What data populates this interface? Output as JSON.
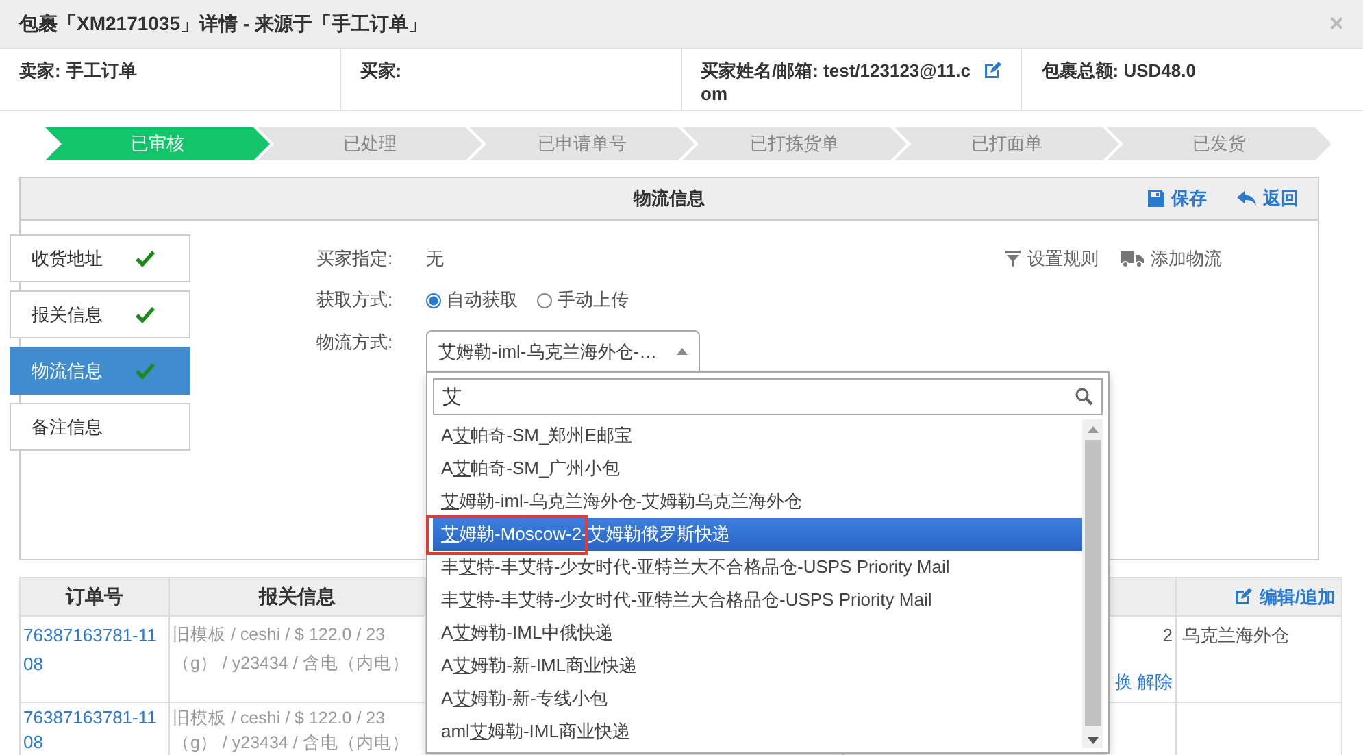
{
  "window": {
    "title_before": "包裹「",
    "title_code": "XM2171035",
    "title_after": "」详情 - 来源于「手工订单」",
    "close": "×"
  },
  "info": [
    {
      "label": "卖家:",
      "value": "手工订单",
      "editable": false
    },
    {
      "label": "买家:",
      "editable": false
    },
    {
      "label": "买家姓名/邮箱:",
      "value": "test/123123@11.com",
      "editable": true
    },
    {
      "label": "包裹总额:",
      "value": "USD48.0",
      "editable": false
    }
  ],
  "steps": [
    {
      "label": "已审核",
      "done": true
    },
    {
      "label": "已处理",
      "done": false
    },
    {
      "label": "已申请单号",
      "done": false
    },
    {
      "label": "已打拣货单",
      "done": false
    },
    {
      "label": "已打面单",
      "done": false
    },
    {
      "label": "已发货",
      "done": false
    }
  ],
  "panel": {
    "title": "物流信息",
    "actions": [
      {
        "kind": "save",
        "label": "保存"
      },
      {
        "kind": "back",
        "label": "返回"
      }
    ]
  },
  "sidebar": {
    "items": [
      {
        "label": "收货地址",
        "done": true,
        "selected": false
      },
      {
        "label": "报关信息",
        "done": true,
        "selected": false
      },
      {
        "label": "物流信息",
        "done": true,
        "selected": true
      },
      {
        "label": "备注信息",
        "done": false,
        "selected": false
      }
    ]
  },
  "form": {
    "buyer_label": "买家指定:",
    "buyer_value": "无",
    "method_label": "获取方式:",
    "methods": [
      {
        "label": "自动获取",
        "selected": true
      },
      {
        "label": "手动上传",
        "selected": false
      }
    ],
    "shipping_label": "物流方式:",
    "shipping_value": "艾姆勒-iml-乌克兰海外仓-…",
    "tools": [
      {
        "kind": "filter",
        "label": "设置规则"
      },
      {
        "kind": "truck",
        "label": "添加物流"
      }
    ]
  },
  "dropdown": {
    "search_value": "艾",
    "items": [
      {
        "before": "A",
        "match": "艾",
        "after": "帕奇-SM_郑州E邮宝",
        "selected": false
      },
      {
        "before": "A",
        "match": "艾",
        "after": "帕奇-SM_广州小包",
        "selected": false
      },
      {
        "match": "艾",
        "after": "姆勒-iml-乌克兰海外仓-艾姆勒乌克兰海外仓",
        "selected": false
      },
      {
        "match": "艾",
        "after": "姆勒-Moscow-2-艾姆勒俄罗斯快递",
        "selected": true
      },
      {
        "before": "丰",
        "match": "艾",
        "after": "特-丰艾特-少女时代-亚特兰大不合格品仓-USPS Priority Mail",
        "selected": false
      },
      {
        "before": "丰",
        "match": "艾",
        "after": "特-丰艾特-少女时代-亚特兰大合格品仓-USPS Priority Mail",
        "selected": false
      },
      {
        "before": "A",
        "match": "艾",
        "after": "姆勒-IML中俄快递",
        "selected": false
      },
      {
        "before": "A",
        "match": "艾",
        "after": "姆勒-新-IML商业快递",
        "selected": false
      },
      {
        "before": "A",
        "match": "艾",
        "after": "姆勒-新-专线小包",
        "selected": false
      },
      {
        "before": "aml",
        "match": "艾",
        "after": "姆勒-IML商业快递",
        "selected": false
      }
    ]
  },
  "table": {
    "columns": [
      "订单号",
      "报关信息"
    ],
    "edit_action": "编辑/追加",
    "rows": [
      {
        "order": "76387163781-1108",
        "customs": "旧模板 / ceshi / $ 122.0 / 23（g） / y23434 / 含电（内电）",
        "column_4": "2",
        "links": [
          "换",
          "解除"
        ],
        "column_5": "乌克兰海外仓"
      },
      {
        "order": "76387163781-1108",
        "customs": "旧模板 / ceshi / $ 122.0 / 23（g） / y23434 / 含电（内电）"
      }
    ]
  }
}
